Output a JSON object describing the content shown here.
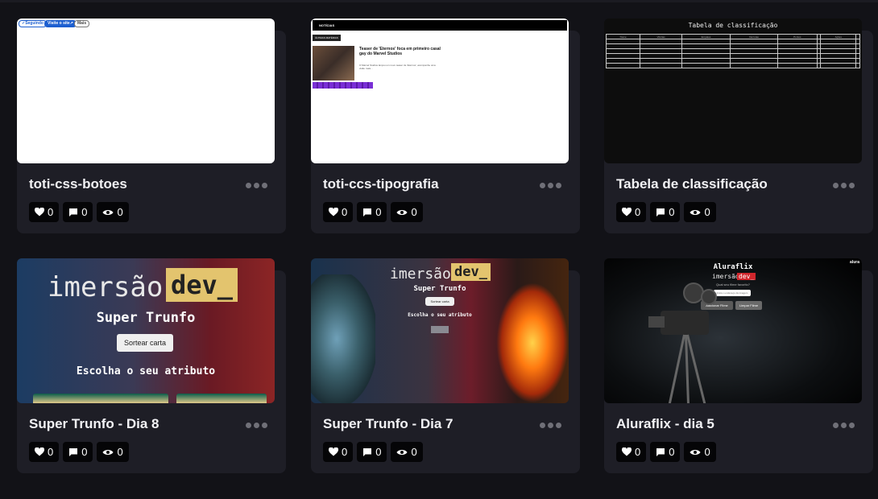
{
  "projects": [
    {
      "title": "toti-css-botoes",
      "likes": "0",
      "comments": "0",
      "views": "0",
      "thumb": {
        "pills": [
          "✓Seguindo",
          "Visite o site↗",
          "Mais"
        ]
      }
    },
    {
      "title": "toti-ccs-tipografia",
      "likes": "0",
      "comments": "0",
      "views": "0",
      "thumb": {
        "bar": "NOTÍCIAS",
        "tag": "ÚLTIMAS MATÉRIAS",
        "headline": "Teaser de 'Eternos' foca em primeiro casal gay do Marvel Studios",
        "sub": "O Marvel Studios lançou um novo teaser de 'Eternos', acompanhe uma visão mais..."
      }
    },
    {
      "title": "Tabela de classificação",
      "likes": "0",
      "comments": "0",
      "views": "0",
      "thumb": {
        "heading": "Tabela de classificação",
        "columns": [
          "Nome",
          "Vitórias",
          "Empates",
          "Derrotas",
          "Pontos",
          "",
          "Ações",
          ""
        ]
      }
    },
    {
      "title": "Super Trunfo - Dia 8",
      "likes": "0",
      "comments": "0",
      "views": "0",
      "thumb": {
        "logo": "imersão",
        "logo_box": "dev_",
        "subtitle": "Super Trunfo",
        "button": "Sortear carta",
        "prompt": "Escolha o seu atributo"
      }
    },
    {
      "title": "Super Trunfo - Dia 7",
      "likes": "0",
      "comments": "0",
      "views": "0",
      "thumb": {
        "logo": "imersão",
        "logo_box": "dev_",
        "subtitle": "Super Trunfo",
        "button": "Sortear carta",
        "prompt": "Escolha o seu atributo"
      }
    },
    {
      "title": "Aluraflix - dia 5",
      "likes": "0",
      "comments": "0",
      "views": "0",
      "thumb": {
        "heading": "Aluraflix",
        "logo": "imersão",
        "logo_box": "dev_",
        "question": "Qual seu filme favorito?",
        "input_placeholder": "Insira o endereço da imagem",
        "add_button": "Adicionar Filme",
        "clear_button": "Limpar Filme",
        "corner": "alura"
      }
    }
  ],
  "colors": {
    "card_bg": "#1e1e26",
    "page_bg": "#121217",
    "stat_bg": "#050507",
    "accent_gold": "#e3c46e"
  },
  "icons": {
    "like": "heart-icon",
    "comment": "comment-icon",
    "view": "eye-icon",
    "more": "more-dots-icon"
  }
}
